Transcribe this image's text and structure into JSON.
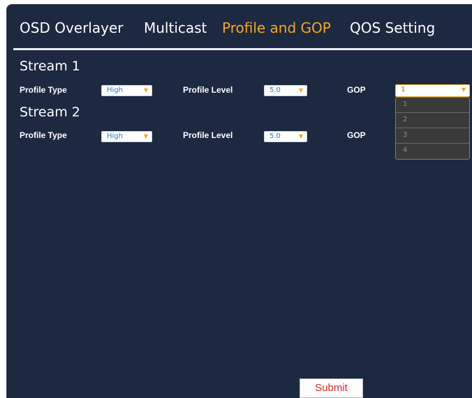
{
  "tabs": [
    {
      "label": "OSD Overlayer",
      "active": false
    },
    {
      "label": "Multicast",
      "active": false
    },
    {
      "label": "Profile and GOP",
      "active": true
    },
    {
      "label": "QOS Setting",
      "active": false
    }
  ],
  "streams": [
    {
      "title": "Stream 1",
      "profile_type_label": "Profile Type",
      "profile_type_value": "High",
      "profile_level_label": "Profile Level",
      "profile_level_value": "5.0",
      "gop_label": "GOP",
      "gop_value": "1"
    },
    {
      "title": "Stream 2",
      "profile_type_label": "Profile Type",
      "profile_type_value": "High",
      "profile_level_label": "Profile Level",
      "profile_level_value": "5.0",
      "gop_label": "GOP"
    }
  ],
  "gop_dropdown_options": [
    "1",
    "2",
    "3",
    "4"
  ],
  "submit_label": "Submit",
  "colors": {
    "panel_bg": "#1c2940",
    "active_tab": "#f5a623",
    "submit_text": "#e02a2a"
  }
}
